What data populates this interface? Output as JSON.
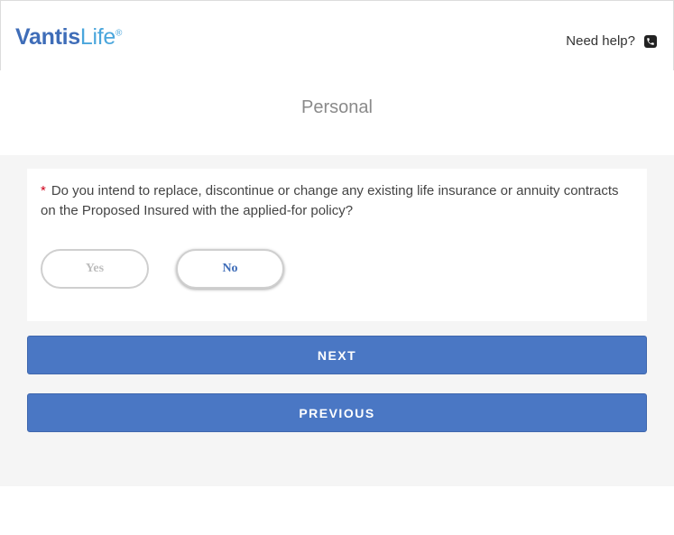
{
  "header": {
    "logo": {
      "brand": "Vantis",
      "life": "Life",
      "reg": "®"
    },
    "help_label": "Need help?",
    "help_icon": "phone-icon"
  },
  "section_title": "Personal",
  "question": {
    "required_marker": "*",
    "text": "Do you intend to replace, discontinue or change any existing life insurance or annuity contracts on the Proposed Insured with the applied-for policy?",
    "options": {
      "yes": "Yes",
      "no": "No"
    },
    "selected": "No"
  },
  "buttons": {
    "next": "NEXT",
    "previous": "PREVIOUS"
  },
  "colors": {
    "brand_blue": "#3f6db8",
    "brand_light_blue": "#4aa6dc",
    "button_blue": "#4a77c4",
    "required_red": "#d0021b"
  }
}
